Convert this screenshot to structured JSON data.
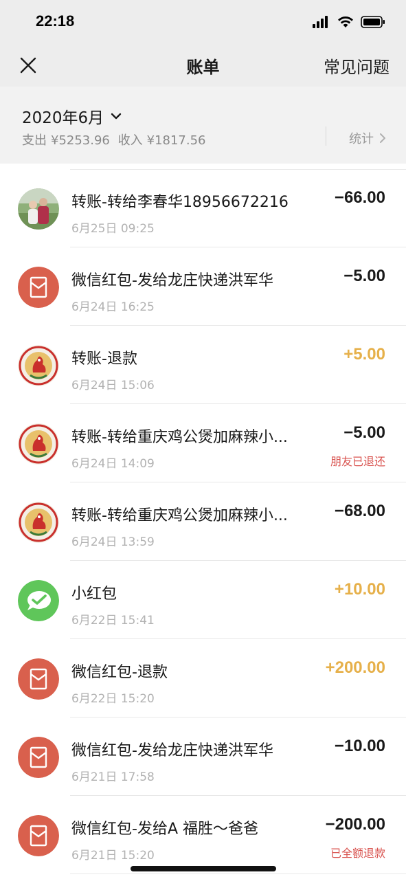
{
  "status": {
    "time": "22:18"
  },
  "nav": {
    "title": "账单",
    "faq_label": "常见问题"
  },
  "filter": {
    "month": "2020年6月",
    "expense_label": "支出",
    "expense_value": "¥5253.96",
    "income_label": "收入",
    "income_value": "¥1817.56",
    "stats_label": "统计"
  },
  "transactions": [
    {
      "title": "转账-转给李春华18956672216",
      "time": "6月25日 09:25",
      "amount": "−66.00",
      "type": "expense",
      "note": "",
      "avatar": "photo"
    },
    {
      "title": "微信红包-发给龙庄快递洪军华",
      "time": "6月24日 16:25",
      "amount": "−5.00",
      "type": "expense",
      "note": "",
      "avatar": "red-packet"
    },
    {
      "title": "转账-退款",
      "time": "6月24日 15:06",
      "amount": "+5.00",
      "type": "income",
      "note": "",
      "avatar": "chicken-logo"
    },
    {
      "title": "转账-转给重庆鸡公煲加麻辣小...",
      "time": "6月24日 14:09",
      "amount": "−5.00",
      "type": "expense",
      "note": "朋友已退还",
      "avatar": "chicken-logo"
    },
    {
      "title": "转账-转给重庆鸡公煲加麻辣小...",
      "time": "6月24日 13:59",
      "amount": "−68.00",
      "type": "expense",
      "note": "",
      "avatar": "chicken-logo"
    },
    {
      "title": "小红包",
      "time": "6月22日 15:41",
      "amount": "+10.00",
      "type": "income",
      "note": "",
      "avatar": "wechat"
    },
    {
      "title": "微信红包-退款",
      "time": "6月22日 15:20",
      "amount": "+200.00",
      "type": "income",
      "note": "",
      "avatar": "red-packet"
    },
    {
      "title": "微信红包-发给龙庄快递洪军华",
      "time": "6月21日 17:58",
      "amount": "−10.00",
      "type": "expense",
      "note": "",
      "avatar": "red-packet"
    },
    {
      "title": "微信红包-发给A 福胜～爸爸",
      "time": "6月21日 15:20",
      "amount": "−200.00",
      "type": "expense",
      "note": "已全额退款",
      "avatar": "red-packet"
    }
  ],
  "colors": {
    "income": "#e6b04a",
    "refund_note": "#d9534f",
    "red_packet": "#d9604d",
    "wechat_green": "#5fc65a"
  }
}
